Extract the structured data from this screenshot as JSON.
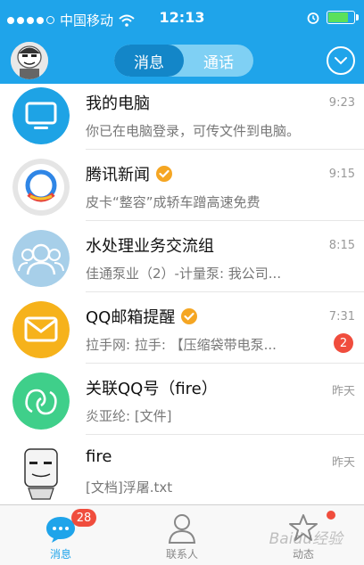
{
  "status_bar": {
    "carrier": "中国移动",
    "time": "12:13"
  },
  "header": {
    "tabs": [
      {
        "label": "消息",
        "active": true
      },
      {
        "label": "通话",
        "active": false
      }
    ],
    "avatar_icon": "user-avatar",
    "menu_icon": "chevron-down-icon"
  },
  "colors": {
    "primary": "#1fa4ea",
    "badge": "#f04d3d",
    "verified": "#f5a623"
  },
  "conversations": [
    {
      "name": "我的电脑",
      "time": "9:23",
      "preview": "你已在电脑登录，可传文件到电脑。",
      "icon": "computer-icon",
      "verified": false
    },
    {
      "name": "腾讯新闻",
      "time": "9:15",
      "preview": "皮卡“整容”成轿车蹭高速免费",
      "icon": "tencent-news-icon",
      "verified": true
    },
    {
      "name": "水处理业务交流组",
      "time": "8:15",
      "preview": "佳通泵业（2）-计量泵: 我公司...",
      "icon": "group-icon",
      "verified": false
    },
    {
      "name": "QQ邮箱提醒",
      "time": "7:31",
      "preview": "拉手网: 拉手:   【压缩袋带电泵...",
      "icon": "mail-icon",
      "verified": true,
      "badge": "2"
    },
    {
      "name": "关联QQ号（fire）",
      "time": "昨天",
      "preview": "炎亚纶: [文件]",
      "icon": "linked-account-icon",
      "verified": false
    },
    {
      "name": "fire",
      "time": "昨天",
      "preview": "[文档]浮屠.txt",
      "icon": "fire-avatar",
      "verified": false
    }
  ],
  "tabbar": {
    "tabs": [
      {
        "label": "消息",
        "icon": "chat-bubble-icon",
        "badge": "28",
        "active": true
      },
      {
        "label": "联系人",
        "icon": "contacts-icon",
        "active": false
      },
      {
        "label": "动态",
        "icon": "star-icon",
        "active": false,
        "dot": true
      }
    ]
  },
  "watermark": "Baidu经验"
}
